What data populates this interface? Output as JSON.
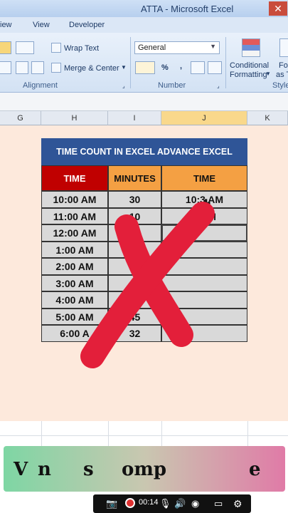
{
  "window": {
    "title": "ATTA - Microsoft Excel",
    "close_glyph": "✕"
  },
  "tabs": [
    "iew",
    "View",
    "Developer"
  ],
  "ribbon": {
    "wrap_text": "Wrap Text",
    "merge_center": "Merge & Center",
    "number_format": "General",
    "conditional_formatting_1": "Conditional",
    "conditional_formatting_2": "Formatting",
    "format_as_table_1": "Fo",
    "format_as_table_2": "as T",
    "percent": "%",
    "comma": ",",
    "inc_decimal": "+.0\n.00",
    "dec_decimal": ".00\n+.0",
    "groups": {
      "alignment": "Alignment",
      "number": "Number",
      "styles": "Style"
    }
  },
  "columns": [
    "G",
    "H",
    "I",
    "J",
    "K"
  ],
  "table": {
    "title": "TIME  COUNT IN EXCEL ADVANCE EXCEL",
    "headers": [
      "TIME",
      "MINUTES",
      "TIME"
    ],
    "rows": [
      [
        "10:00 AM",
        "30",
        "10:3  AM"
      ],
      [
        "11:00 AM",
        "10",
        "1    AM"
      ],
      [
        "12:00 AM",
        "",
        ""
      ],
      [
        "1:00 AM",
        "",
        ""
      ],
      [
        "2:00 AM",
        "",
        ""
      ],
      [
        "3:00 AM",
        "",
        ""
      ],
      [
        "4:00 AM",
        "",
        ""
      ],
      [
        "5:00 AM",
        "45",
        ""
      ],
      [
        "6:00 A",
        "32",
        ""
      ]
    ]
  },
  "banner": {
    "chars": [
      "V",
      "n",
      "s",
      "omp",
      "e"
    ]
  },
  "recorder": {
    "time": "00:14"
  },
  "colors": {
    "accent": "#2f5597",
    "header_red": "#c00000",
    "header_orange": "#f4a043",
    "x_red": "#e31f3a"
  }
}
